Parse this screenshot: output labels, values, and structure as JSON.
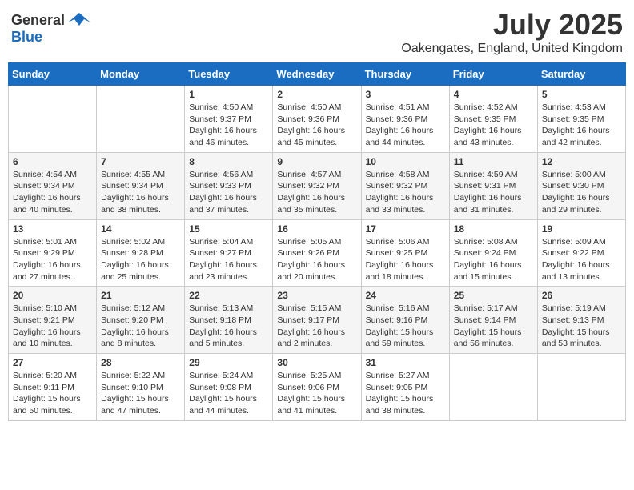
{
  "header": {
    "logo_general": "General",
    "logo_blue": "Blue",
    "title": "July 2025",
    "subtitle": "Oakengates, England, United Kingdom"
  },
  "days_of_week": [
    "Sunday",
    "Monday",
    "Tuesday",
    "Wednesday",
    "Thursday",
    "Friday",
    "Saturday"
  ],
  "weeks": [
    [
      {
        "day": "",
        "info": ""
      },
      {
        "day": "",
        "info": ""
      },
      {
        "day": "1",
        "info": "Sunrise: 4:50 AM\nSunset: 9:37 PM\nDaylight: 16 hours and 46 minutes."
      },
      {
        "day": "2",
        "info": "Sunrise: 4:50 AM\nSunset: 9:36 PM\nDaylight: 16 hours and 45 minutes."
      },
      {
        "day": "3",
        "info": "Sunrise: 4:51 AM\nSunset: 9:36 PM\nDaylight: 16 hours and 44 minutes."
      },
      {
        "day": "4",
        "info": "Sunrise: 4:52 AM\nSunset: 9:35 PM\nDaylight: 16 hours and 43 minutes."
      },
      {
        "day": "5",
        "info": "Sunrise: 4:53 AM\nSunset: 9:35 PM\nDaylight: 16 hours and 42 minutes."
      }
    ],
    [
      {
        "day": "6",
        "info": "Sunrise: 4:54 AM\nSunset: 9:34 PM\nDaylight: 16 hours and 40 minutes."
      },
      {
        "day": "7",
        "info": "Sunrise: 4:55 AM\nSunset: 9:34 PM\nDaylight: 16 hours and 38 minutes."
      },
      {
        "day": "8",
        "info": "Sunrise: 4:56 AM\nSunset: 9:33 PM\nDaylight: 16 hours and 37 minutes."
      },
      {
        "day": "9",
        "info": "Sunrise: 4:57 AM\nSunset: 9:32 PM\nDaylight: 16 hours and 35 minutes."
      },
      {
        "day": "10",
        "info": "Sunrise: 4:58 AM\nSunset: 9:32 PM\nDaylight: 16 hours and 33 minutes."
      },
      {
        "day": "11",
        "info": "Sunrise: 4:59 AM\nSunset: 9:31 PM\nDaylight: 16 hours and 31 minutes."
      },
      {
        "day": "12",
        "info": "Sunrise: 5:00 AM\nSunset: 9:30 PM\nDaylight: 16 hours and 29 minutes."
      }
    ],
    [
      {
        "day": "13",
        "info": "Sunrise: 5:01 AM\nSunset: 9:29 PM\nDaylight: 16 hours and 27 minutes."
      },
      {
        "day": "14",
        "info": "Sunrise: 5:02 AM\nSunset: 9:28 PM\nDaylight: 16 hours and 25 minutes."
      },
      {
        "day": "15",
        "info": "Sunrise: 5:04 AM\nSunset: 9:27 PM\nDaylight: 16 hours and 23 minutes."
      },
      {
        "day": "16",
        "info": "Sunrise: 5:05 AM\nSunset: 9:26 PM\nDaylight: 16 hours and 20 minutes."
      },
      {
        "day": "17",
        "info": "Sunrise: 5:06 AM\nSunset: 9:25 PM\nDaylight: 16 hours and 18 minutes."
      },
      {
        "day": "18",
        "info": "Sunrise: 5:08 AM\nSunset: 9:24 PM\nDaylight: 16 hours and 15 minutes."
      },
      {
        "day": "19",
        "info": "Sunrise: 5:09 AM\nSunset: 9:22 PM\nDaylight: 16 hours and 13 minutes."
      }
    ],
    [
      {
        "day": "20",
        "info": "Sunrise: 5:10 AM\nSunset: 9:21 PM\nDaylight: 16 hours and 10 minutes."
      },
      {
        "day": "21",
        "info": "Sunrise: 5:12 AM\nSunset: 9:20 PM\nDaylight: 16 hours and 8 minutes."
      },
      {
        "day": "22",
        "info": "Sunrise: 5:13 AM\nSunset: 9:18 PM\nDaylight: 16 hours and 5 minutes."
      },
      {
        "day": "23",
        "info": "Sunrise: 5:15 AM\nSunset: 9:17 PM\nDaylight: 16 hours and 2 minutes."
      },
      {
        "day": "24",
        "info": "Sunrise: 5:16 AM\nSunset: 9:16 PM\nDaylight: 15 hours and 59 minutes."
      },
      {
        "day": "25",
        "info": "Sunrise: 5:17 AM\nSunset: 9:14 PM\nDaylight: 15 hours and 56 minutes."
      },
      {
        "day": "26",
        "info": "Sunrise: 5:19 AM\nSunset: 9:13 PM\nDaylight: 15 hours and 53 minutes."
      }
    ],
    [
      {
        "day": "27",
        "info": "Sunrise: 5:20 AM\nSunset: 9:11 PM\nDaylight: 15 hours and 50 minutes."
      },
      {
        "day": "28",
        "info": "Sunrise: 5:22 AM\nSunset: 9:10 PM\nDaylight: 15 hours and 47 minutes."
      },
      {
        "day": "29",
        "info": "Sunrise: 5:24 AM\nSunset: 9:08 PM\nDaylight: 15 hours and 44 minutes."
      },
      {
        "day": "30",
        "info": "Sunrise: 5:25 AM\nSunset: 9:06 PM\nDaylight: 15 hours and 41 minutes."
      },
      {
        "day": "31",
        "info": "Sunrise: 5:27 AM\nSunset: 9:05 PM\nDaylight: 15 hours and 38 minutes."
      },
      {
        "day": "",
        "info": ""
      },
      {
        "day": "",
        "info": ""
      }
    ]
  ]
}
